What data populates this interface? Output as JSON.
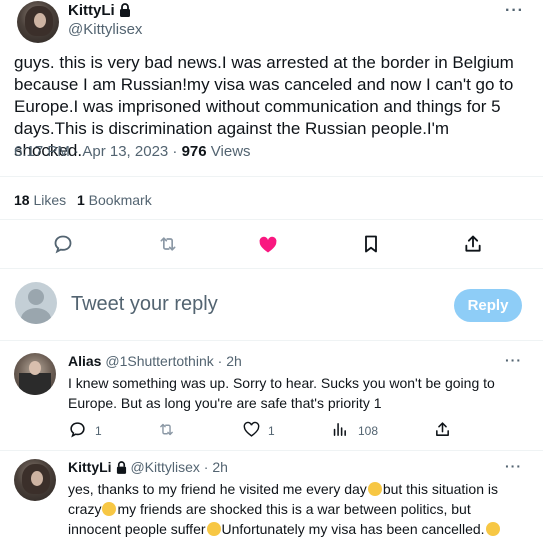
{
  "tweet": {
    "author_name": "KittyLi",
    "author_handle": "@Kittylisex",
    "text": "guys. this is very bad news.I was arrested at the border in Belgium because I am Russian!my visa was canceled and now I can't go to Europe.I was imprisoned without communication and things for 5 days.This is discrimination against the Russian people.I'm shocked.",
    "time": "6:17 PM · Apr 13, 2023 · ",
    "views_count": "976",
    "views_label": " Views",
    "likes_count": "18",
    "likes_label": " Likes",
    "bookmarks_count": "1",
    "bookmarks_label": " Bookmark",
    "more_label": "···"
  },
  "reply_box": {
    "placeholder": "Tweet your reply",
    "button_label": "Reply"
  },
  "replies": [
    {
      "name": "Alias",
      "handle": "@1Shuttertothink",
      "time": "· 2h",
      "text": "I knew something was up. Sorry to hear. Sucks you won't be going to Europe. But as long you're are safe that's priority 1",
      "reply_count": "1",
      "like_count": "1",
      "view_count": "108"
    },
    {
      "name": "KittyLi",
      "handle": "@Kittylisex",
      "time": "· 2h",
      "text_1": "yes, thanks to my friend he visited me every day",
      "text_2": "but this situation is crazy",
      "text_3": "my friends are shocked this is a war between politics, but innocent people suffer",
      "text_4": "Unfortunately my visa has been cancelled."
    }
  ],
  "colors": {
    "accent": "#1d9bf0",
    "like": "#f91880",
    "muted": "#536471"
  }
}
